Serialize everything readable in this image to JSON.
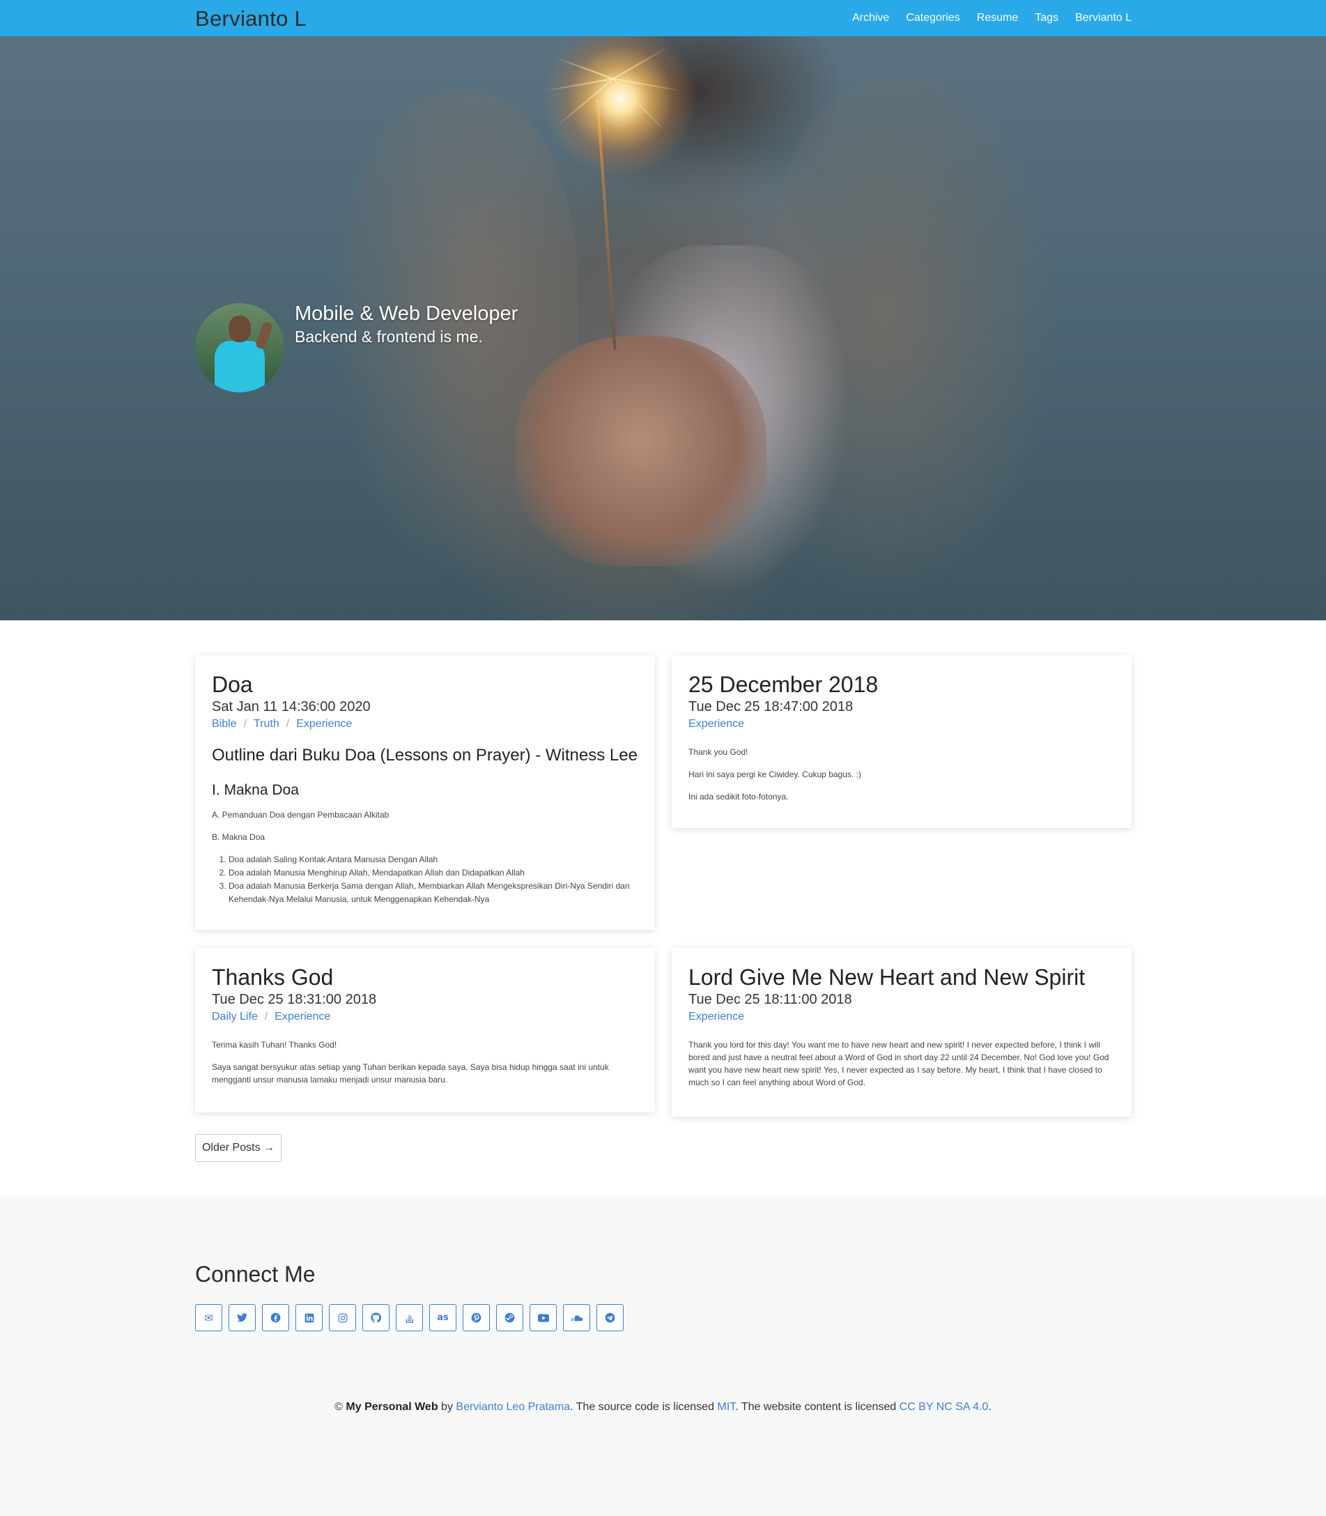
{
  "nav": {
    "brand": "Bervianto L",
    "links": [
      "Archive",
      "Categories",
      "Resume",
      "Tags",
      "Bervianto L"
    ]
  },
  "hero": {
    "title": "Mobile & Web Developer",
    "subtitle": "Backend & frontend is me."
  },
  "posts": [
    {
      "title": "Doa",
      "date": "Sat Jan 11 14:36:00 2020",
      "tags": [
        "Bible",
        "Truth",
        "Experience"
      ],
      "heading": "Outline dari Buku Doa (Lessons on Prayer) - Witness Lee",
      "subheading": "I. Makna Doa",
      "paragraphs": [
        "A. Pemanduan Doa dengan Pembacaan Alkitab",
        "B. Makna Doa"
      ],
      "list": [
        "Doa adalah Saling Kontak Antara Manusia Dengan Allah",
        "Doa adalah Manusia Menghirup Allah, Mendapatkan Allah dan Didapatkan Allah",
        "Doa adalah Manusia Berkerja Sama dengan Allah, Membiarkan Allah Mengekspresikan Diri-Nya Sendiri dan Kehendak-Nya Melalui Manusia, untuk Menggenapkan Kehendak-Nya"
      ]
    },
    {
      "title": "25 December 2018",
      "date": "Tue Dec 25 18:47:00 2018",
      "tags": [
        "Experience"
      ],
      "paragraphs": [
        "Thank you God!",
        "Hari ini saya pergi ke Ciwidey. Cukup bagus. :)",
        "Ini ada sedikit foto-fotonya."
      ]
    },
    {
      "title": "Thanks God",
      "date": "Tue Dec 25 18:31:00 2018",
      "tags": [
        "Daily Life",
        "Experience"
      ],
      "paragraphs": [
        "Terima kasih Tuhan! Thanks God!",
        "Saya sangat bersyukur atas setiap yang Tuhan berikan kepada saya. Saya bisa hidup hingga saat ini untuk mengganti unsur manusia lamaku menjadi unsur manusia baru."
      ]
    },
    {
      "title": "Lord Give Me New Heart and New Spirit",
      "date": "Tue Dec 25 18:11:00 2018",
      "tags": [
        "Experience"
      ],
      "paragraphs": [
        "Thank you lord for this day! You want me to have new heart and new spirit! I never expected before, I think I will bored and just have a neutral feel about a Word of God in short day 22 until 24 December. No! God love you! God want you have new heart new spirit! Yes, I never expected as I say before. My heart, I think that I have closed to much so I can feel anything about Word of God."
      ]
    }
  ],
  "pagination": {
    "older": "Older Posts →"
  },
  "footer": {
    "connect_title": "Connect Me",
    "social_icons": [
      "email-icon",
      "twitter-icon",
      "facebook-icon",
      "linkedin-icon",
      "instagram-icon",
      "github-icon",
      "stackoverflow-icon",
      "lastfm-icon",
      "pinterest-icon",
      "steam-icon",
      "youtube-icon",
      "soundcloud-icon",
      "telegram-icon"
    ],
    "copyright": {
      "prefix": "© ",
      "site": "My Personal Web",
      "by": " by ",
      "author": "Bervianto Leo Pratama",
      "mid1": ". The source code is licensed ",
      "license_code": "MIT",
      "mid2": ". The website content is licensed ",
      "license_content": "CC BY NC SA 4.0",
      "end": "."
    }
  },
  "colors": {
    "navbar": "#29a9e7",
    "link": "#3d7fd0",
    "footer_bg": "#f8f8f8"
  }
}
